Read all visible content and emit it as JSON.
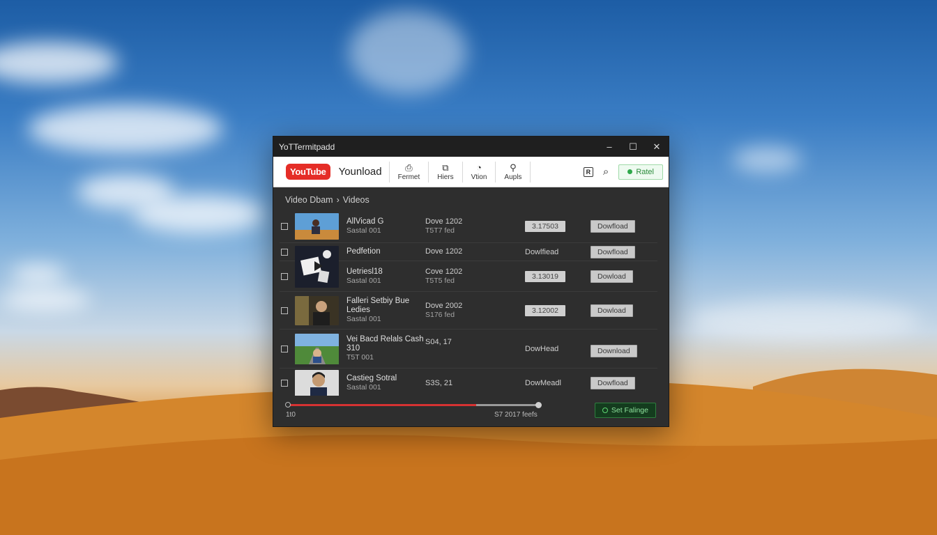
{
  "window": {
    "title": "YoTTermitpadd",
    "controls": {
      "minimize": "–",
      "maximize": "☐",
      "close": "✕"
    }
  },
  "toolbar": {
    "logo_text": "YouTube",
    "brand": "Younload",
    "tools": [
      {
        "icon": "format-icon",
        "glyph": "⎙",
        "label": "Fermet"
      },
      {
        "icon": "filters-icon",
        "glyph": "⧉",
        "label": "Hiers"
      },
      {
        "icon": "video-icon",
        "glyph": "◔",
        "label": "Vtion"
      },
      {
        "icon": "audio-icon",
        "glyph": "⚲",
        "label": "Aupls"
      }
    ],
    "right_icons": [
      {
        "icon": "box-r-icon",
        "glyph": "R"
      },
      {
        "icon": "search-icon",
        "glyph": "⌕"
      }
    ],
    "panel_button": "Ratel"
  },
  "breadcrumb": {
    "root": "Video Dbam",
    "separator": "›",
    "current": "Videos"
  },
  "videos": [
    {
      "title": "AllVicad G",
      "subtitle": "Sastal 001",
      "meta1": "Dove 1202",
      "meta2": "T5T7 fed",
      "state_type": "pill",
      "state": "3.17503",
      "button": "Dowfload"
    },
    {
      "title": "Pedfetion",
      "subtitle": "",
      "meta1": "Dove 1202",
      "meta2": "",
      "state_type": "text",
      "state": "Dowlfiead",
      "button": "Dowfload"
    },
    {
      "title": "Uetriesl18",
      "subtitle": "Sastal 001",
      "meta1": "Cove 1202",
      "meta2": "T5T5 fed",
      "state_type": "pill",
      "state": "3.13019",
      "button": "Dowload"
    },
    {
      "title": "Falleri Setbiy Bue Ledies",
      "subtitle": "Sastal 001",
      "meta1": "Dove 2002",
      "meta2": "S176 fed",
      "state_type": "pill",
      "state": "3.12002",
      "button": "Dowload"
    },
    {
      "title": "Vei Bacd Relals Cash 310",
      "subtitle": "T5T 001",
      "meta1": "S04, 17",
      "meta2": "",
      "state_type": "text",
      "state": "DowHead",
      "button": "Download"
    },
    {
      "title": "Castieg Sotral",
      "subtitle": "Sastal 001",
      "meta1": "S3S, 21",
      "meta2": "",
      "state_type": "text",
      "state": "DowMeadl",
      "button": "Dowfload"
    }
  ],
  "footer": {
    "left_label": "1t0",
    "right_label": "S7 2017 feefs",
    "progress": 0.75,
    "settings_button": "Set Falinge"
  },
  "colors": {
    "window_bg": "#2e2e2e",
    "titlebar_bg": "#1f1f1f",
    "toolbar_bg": "#ffffff",
    "youtube_red": "#e52d27",
    "progress_red": "#d63232",
    "green_accent": "#2fa84a"
  }
}
